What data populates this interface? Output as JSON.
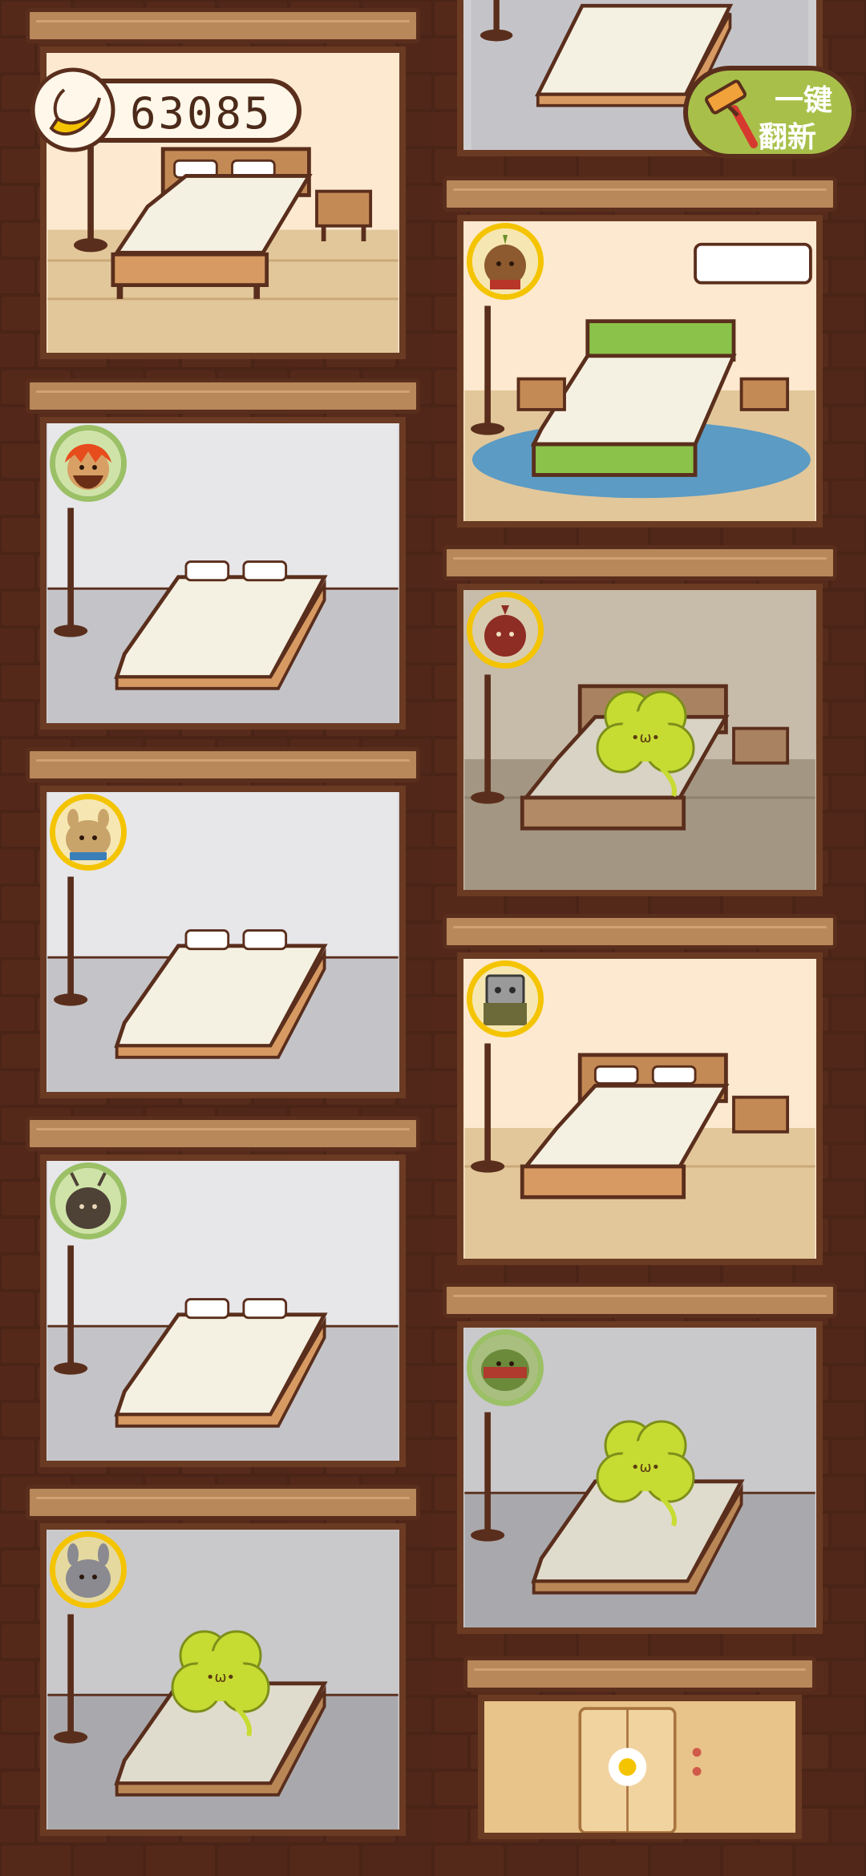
{
  "hud": {
    "coins": "63085",
    "refresh_button": {
      "line1": "一键",
      "line2": "翻新"
    }
  },
  "icons": {
    "coin": "banana-icon",
    "refresh": "paint-roller-icon"
  },
  "colors": {
    "wall": "#4a2417",
    "beam": "#b8875a",
    "refresh_button": "#a8c04a",
    "guest_border_gold": "#f4c400",
    "guest_border_green": "#9bc066",
    "clover": "#c7dc32"
  },
  "rooms": [
    {
      "id": "left-1",
      "style": "furnished",
      "guest": "none"
    },
    {
      "id": "left-2",
      "style": "basic",
      "guest": "red-haired",
      "badge": "green"
    },
    {
      "id": "left-3",
      "style": "basic",
      "guest": "tan-animal",
      "badge": "gold"
    },
    {
      "id": "left-4",
      "style": "basic",
      "guest": "dark-bug",
      "badge": "green"
    },
    {
      "id": "left-5",
      "style": "basic",
      "guest": "gray-bunny",
      "badge": "gold",
      "clover": true
    },
    {
      "id": "right-1",
      "style": "basic",
      "guest": "none"
    },
    {
      "id": "right-2",
      "style": "deluxe-green",
      "guest": "onion-head",
      "badge": "gold"
    },
    {
      "id": "right-3",
      "style": "furnished-dark",
      "guest": "red-bird",
      "badge": "gold",
      "clover": true
    },
    {
      "id": "right-4",
      "style": "furnished",
      "guest": "robot",
      "badge": "gold"
    },
    {
      "id": "right-5",
      "style": "basic",
      "guest": "watermelon",
      "badge": "green",
      "clover": true
    },
    {
      "id": "right-6",
      "style": "locked-door",
      "guest": "none"
    }
  ]
}
